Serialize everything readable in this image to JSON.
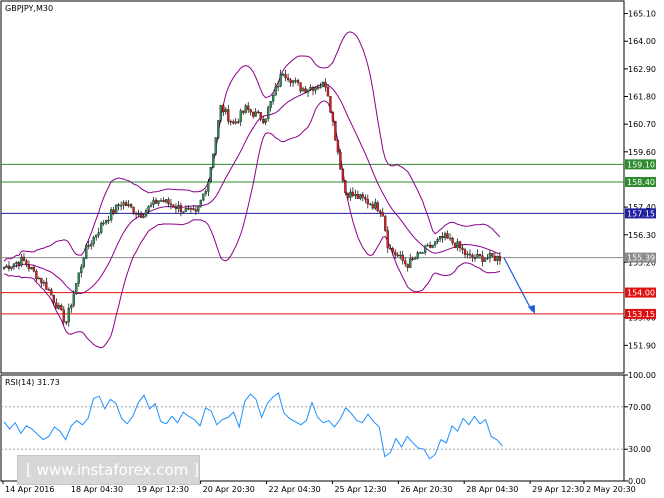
{
  "chart_title": "GBPJPY,M30",
  "rsi_label": "RSI(14) 31.73",
  "watermark": "[ www.instaforex.com ]",
  "colors": {
    "candle_up": "#2e8b57",
    "candle_down": "#d22020",
    "bollinger": "#8b008b",
    "rsi_line": "#1e90ff",
    "support_resistance_green": "#2e8b2e",
    "pivot_blue": "#1f1fa0",
    "target_red": "#e01010",
    "current_price_gray": "#8a8a8a",
    "arrow": "#1e5fd8"
  },
  "chart_data": [
    {
      "type": "candlestick",
      "symbol": "GBPJPY",
      "timeframe": "M30",
      "ylim": [
        150.8,
        165.6
      ],
      "y_ticks": [
        "165.10",
        "164.00",
        "162.90",
        "161.80",
        "160.70",
        "159.60",
        "157.40",
        "156.30",
        "155.20",
        "153.00",
        "151.90"
      ],
      "x_ticks": [
        "14 Apr 2016",
        "18 Apr 04:30",
        "19 Apr 12:30",
        "20 Apr 20:30",
        "22 Apr 04:30",
        "25 Apr 12:30",
        "26 Apr 20:30",
        "28 Apr 04:30",
        "29 Apr 12:30",
        "2 May 20:30"
      ],
      "price_path": {
        "x": [
          0,
          0.03,
          0.07,
          0.1,
          0.13,
          0.16,
          0.19,
          0.22,
          0.25,
          0.28,
          0.31,
          0.33,
          0.35,
          0.37,
          0.39,
          0.42,
          0.45,
          0.48,
          0.52,
          0.55,
          0.58,
          0.61,
          0.62,
          0.65,
          0.68,
          0.71,
          0.73,
          0.75,
          0.78,
          0.8,
          1
        ],
        "y": [
          155,
          155.3,
          154.2,
          152.8,
          155.6,
          156.8,
          157.6,
          157.1,
          157.7,
          157.4,
          157.1,
          158.5,
          161.4,
          160.7,
          161.3,
          160.9,
          162.8,
          162.1,
          162.3,
          158,
          157.7,
          157.3,
          155.8,
          155.1,
          155.7,
          156.2,
          155.9,
          155.39,
          155.39,
          155.39,
          155.39
        ]
      },
      "horizontal_levels": [
        {
          "value": "159.10",
          "color": "green"
        },
        {
          "value": "158.40",
          "color": "green"
        },
        {
          "value": "157.15",
          "color": "blue"
        },
        {
          "value": "155.39",
          "color": "gray"
        },
        {
          "value": "154.00",
          "color": "red"
        },
        {
          "value": "153.15",
          "color": "red"
        }
      ],
      "forecast_arrow": {
        "from_price": 155.39,
        "to_price": 153.15,
        "direction": "down"
      }
    },
    {
      "type": "line",
      "indicator": "RSI(14)",
      "last_value": 31.73,
      "ylim": [
        0,
        100
      ],
      "y_ticks": [
        "100.00",
        "70.00",
        "30.00",
        "0.00"
      ],
      "levels": [
        70,
        30
      ],
      "values": [
        56,
        49,
        55,
        45,
        52,
        49,
        44,
        39,
        42,
        51,
        47,
        39,
        52,
        57,
        53,
        59,
        78,
        80,
        68,
        77,
        73,
        59,
        54,
        61,
        74,
        81,
        68,
        73,
        56,
        54,
        61,
        55,
        65,
        61,
        58,
        52,
        69,
        66,
        53,
        58,
        60,
        65,
        51,
        75,
        82,
        77,
        60,
        73,
        79,
        83,
        64,
        59,
        56,
        53,
        57,
        74,
        60,
        55,
        57,
        51,
        58,
        69,
        64,
        57,
        55,
        63,
        56,
        51,
        23,
        27,
        40,
        32,
        42,
        36,
        31,
        30,
        21,
        25,
        39,
        36,
        52,
        47,
        59,
        53,
        61,
        54,
        58,
        42,
        39,
        33
      ]
    }
  ]
}
